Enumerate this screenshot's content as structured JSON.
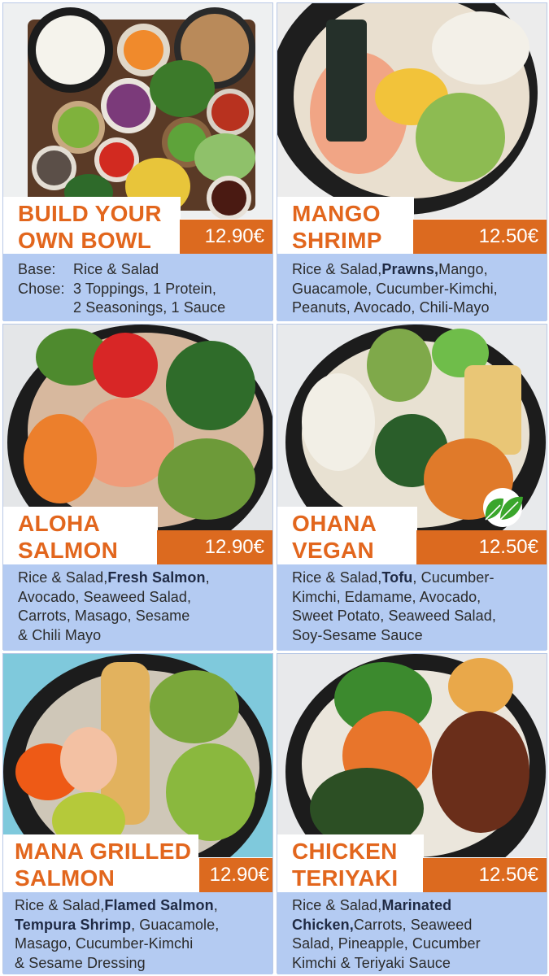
{
  "colors": {
    "accent": "#e2661d",
    "price_bg": "#dc6a1f",
    "desc_bg": "#b4cbf2"
  },
  "cards": [
    {
      "title_lines": [
        "BUILD YOUR",
        "OWN BOWL"
      ],
      "price": "12.90€",
      "base_label": "Base:",
      "base_value": "Rice & Salad",
      "chose_label": "Chose:",
      "chose_lines": [
        "3 Toppings, 1 Protein,",
        "2 Seasonings, 1 Sauce"
      ]
    },
    {
      "title_lines": [
        "MANGO",
        "SHRIMP"
      ],
      "price": "12.50€",
      "desc_lines": [
        [
          {
            "t": "Rice & Salad, "
          },
          {
            "t": "Prawns,",
            "b": true
          },
          {
            "t": " Mango,"
          }
        ],
        [
          {
            "t": "Guacamole, Cucumber-Kimchi,"
          }
        ],
        [
          {
            "t": "Peanuts, Avocado, Chili-Mayo"
          }
        ]
      ]
    },
    {
      "title_lines": [
        "ALOHA",
        "SALMON"
      ],
      "price": "12.90€",
      "desc_lines": [
        [
          {
            "t": "Rice & Salad, "
          },
          {
            "t": "Fresh Salmon",
            "b": true
          },
          {
            "t": ","
          }
        ],
        [
          {
            "t": "Avocado, Seaweed Salad,"
          }
        ],
        [
          {
            "t": "Carrots, Masago, Sesame"
          }
        ],
        [
          {
            "t": "& Chili Mayo"
          }
        ]
      ]
    },
    {
      "title_lines": [
        "OHANA",
        "VEGAN"
      ],
      "price": "12.50€",
      "desc_lines": [
        [
          {
            "t": "Rice & Salad, "
          },
          {
            "t": "Tofu",
            "b": true
          },
          {
            "t": ", Cucumber-"
          }
        ],
        [
          {
            "t": "Kimchi, Edamame, Avocado,"
          }
        ],
        [
          {
            "t": "Sweet Potato, Seaweed Salad,"
          }
        ],
        [
          {
            "t": "Soy-Sesame Sauce"
          }
        ]
      ]
    },
    {
      "title_lines": [
        "MANA GRILLED",
        "SALMON"
      ],
      "price": "12.90€",
      "desc_lines": [
        [
          {
            "t": "Rice & Salad, "
          },
          {
            "t": "Flamed Salmon",
            "b": true
          },
          {
            "t": ","
          }
        ],
        [
          {
            "t": "Tempura Shrimp",
            "b": true
          },
          {
            "t": ", Guacamole,"
          }
        ],
        [
          {
            "t": "Masago, Cucumber-Kimchi"
          }
        ],
        [
          {
            "t": "& Sesame Dressing"
          }
        ]
      ]
    },
    {
      "title_lines": [
        "CHICKEN",
        "TERIYAKI"
      ],
      "price": "12.50€",
      "desc_lines": [
        [
          {
            "t": "Rice & Salad, "
          },
          {
            "t": "Marinated",
            "b": true
          }
        ],
        [
          {
            "t": "Chicken,",
            "b": true
          },
          {
            "t": " Carrots, Seaweed"
          }
        ],
        [
          {
            "t": "Salad, Pineapple, Cucumber"
          }
        ],
        [
          {
            "t": "Kimchi & Teriyaki Sauce"
          }
        ]
      ]
    }
  ]
}
